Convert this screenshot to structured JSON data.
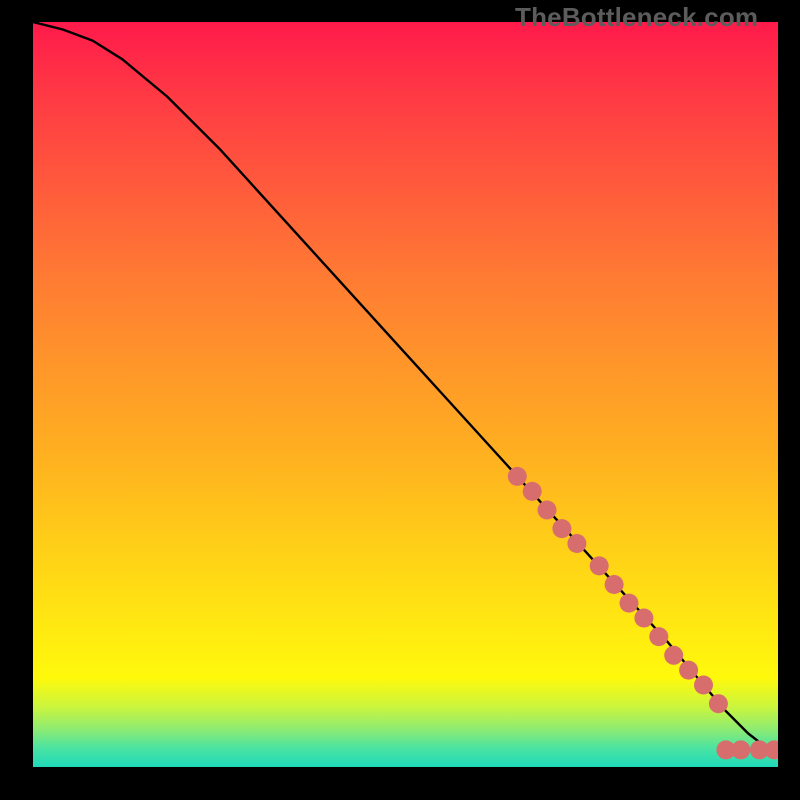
{
  "attribution": "TheBottleneck.com",
  "chart_data": {
    "type": "line",
    "title": "",
    "xlabel": "",
    "ylabel": "",
    "xlim": [
      0,
      100
    ],
    "ylim": [
      0,
      100
    ],
    "series": [
      {
        "name": "curve",
        "x": [
          0,
          4,
          8,
          12,
          18,
          25,
          35,
          45,
          55,
          65,
          75,
          85,
          90,
          93,
          96,
          99,
          100
        ],
        "y": [
          100,
          99,
          97.5,
          95,
          90,
          83,
          72,
          61,
          50,
          39,
          28,
          17,
          11,
          7.5,
          4.5,
          2.2,
          2.2
        ]
      }
    ],
    "markers": [
      {
        "segment": "diagonal",
        "x": [
          65,
          67,
          69,
          71,
          73,
          76,
          78,
          80,
          82,
          84,
          86,
          88,
          90,
          92
        ],
        "y": [
          39,
          37,
          34.5,
          32,
          30,
          27,
          24.5,
          22,
          20,
          17.5,
          15,
          13,
          11,
          8.5
        ]
      },
      {
        "segment": "tail",
        "x": [
          93,
          95,
          97.5,
          99.5
        ],
        "y": [
          2.3,
          2.3,
          2.3,
          2.3
        ]
      }
    ],
    "colors": {
      "line": "#000000",
      "marker": "#d86d6d",
      "gradient_top": "#ff1a4b",
      "gradient_bottom": "#1fd9b9",
      "background": "#000000"
    }
  }
}
